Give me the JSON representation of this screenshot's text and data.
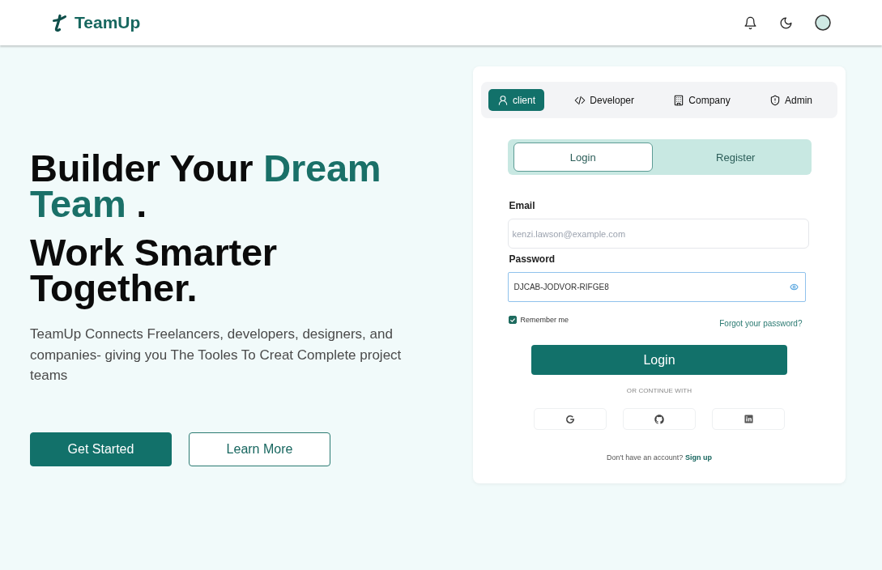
{
  "header": {
    "brand": "TeamUp"
  },
  "hero": {
    "headline": [
      {
        "text": "Builder Your ",
        "accent": false
      },
      {
        "text": "Dream Team",
        "accent": true
      },
      {
        "text": " .",
        "accent": false
      }
    ],
    "subheadline": "Work Smarter Together.",
    "description": "TeamUp Connects Freelancers, developers, designers, and companies- giving you The Tooles To Creat Complete project teams",
    "buttons": [
      {
        "label": "Get Started",
        "kind": "primary"
      },
      {
        "label": "Learn More",
        "kind": "outline"
      }
    ]
  },
  "auth_card": {
    "roles": [
      {
        "label": "client",
        "kind": "user",
        "selected": true
      },
      {
        "label": "Developer",
        "kind": "code",
        "selected": false
      },
      {
        "label": "Company",
        "kind": "building",
        "selected": false
      },
      {
        "label": "Admin",
        "kind": "shield",
        "selected": false
      }
    ],
    "mode_tabs": [
      {
        "label": "Login",
        "selected": true
      },
      {
        "label": "Register",
        "selected": false
      }
    ],
    "email": {
      "label": "Email",
      "placeholder": "kenzi.lawson@example.com"
    },
    "password": {
      "label": "Password",
      "value": "DJCAB-JODVOR-RIFGE8",
      "focused": true
    },
    "remember": {
      "label": "Remember me",
      "checked": true
    },
    "forgot_link": "Forgot your password?",
    "submit": "Login",
    "divider": "OR CONTINUE WITH",
    "social": [
      {
        "kind": "google"
      },
      {
        "kind": "github"
      },
      {
        "kind": "linkedin"
      }
    ],
    "signup": {
      "prompt": "Don't have an account?",
      "link": "Sign up"
    }
  }
}
